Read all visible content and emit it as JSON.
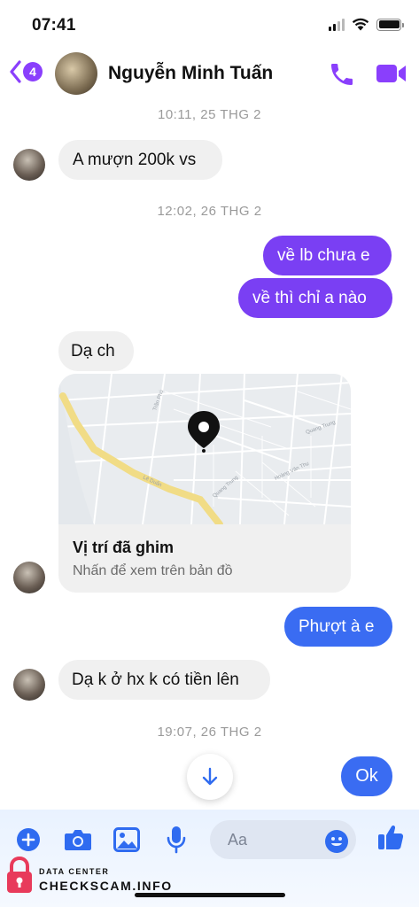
{
  "status_bar": {
    "time": "07:41"
  },
  "header": {
    "back_count": "4",
    "contact_name": "Nguyễn Minh Tuấn"
  },
  "messages": {
    "ts1": "10:11, 25 THG 2",
    "in1": "A mượn 200k vs",
    "ts2": "12:02, 26 THG 2",
    "out1": "về lb chưa e",
    "out2": "về thì chỉ a nào",
    "in2": "Dạ ch",
    "map_title": "Vị trí đã ghim",
    "map_subtitle": "Nhấn để xem trên bản đồ",
    "map_streets": [
      "Trần Phú",
      "Lê Duẩn",
      "Quang Trung",
      "Hoàng Văn Thụ"
    ],
    "out3": "Phượt à e",
    "in3": "Dạ k ở hx k có tiền lên",
    "ts3": "19:07, 26 THG 2",
    "out4": "Ok"
  },
  "composer": {
    "placeholder": "Aa"
  },
  "watermark": {
    "line1": "DATA CENTER",
    "line2": "CHECKSCAM.INFO"
  },
  "colors": {
    "accent_purple": "#7a3ff3",
    "accent_blue": "#3a6cf2",
    "incoming_bubble": "#f0f0f0",
    "icon_blue": "#2f6bf0"
  },
  "icons": [
    "back-chevron-icon",
    "phone-icon",
    "video-camera-icon",
    "location-pin-icon",
    "arrow-down-icon",
    "plus-icon",
    "camera-icon",
    "image-icon",
    "microphone-icon",
    "emoji-icon",
    "thumbs-up-icon",
    "lock-icon"
  ]
}
